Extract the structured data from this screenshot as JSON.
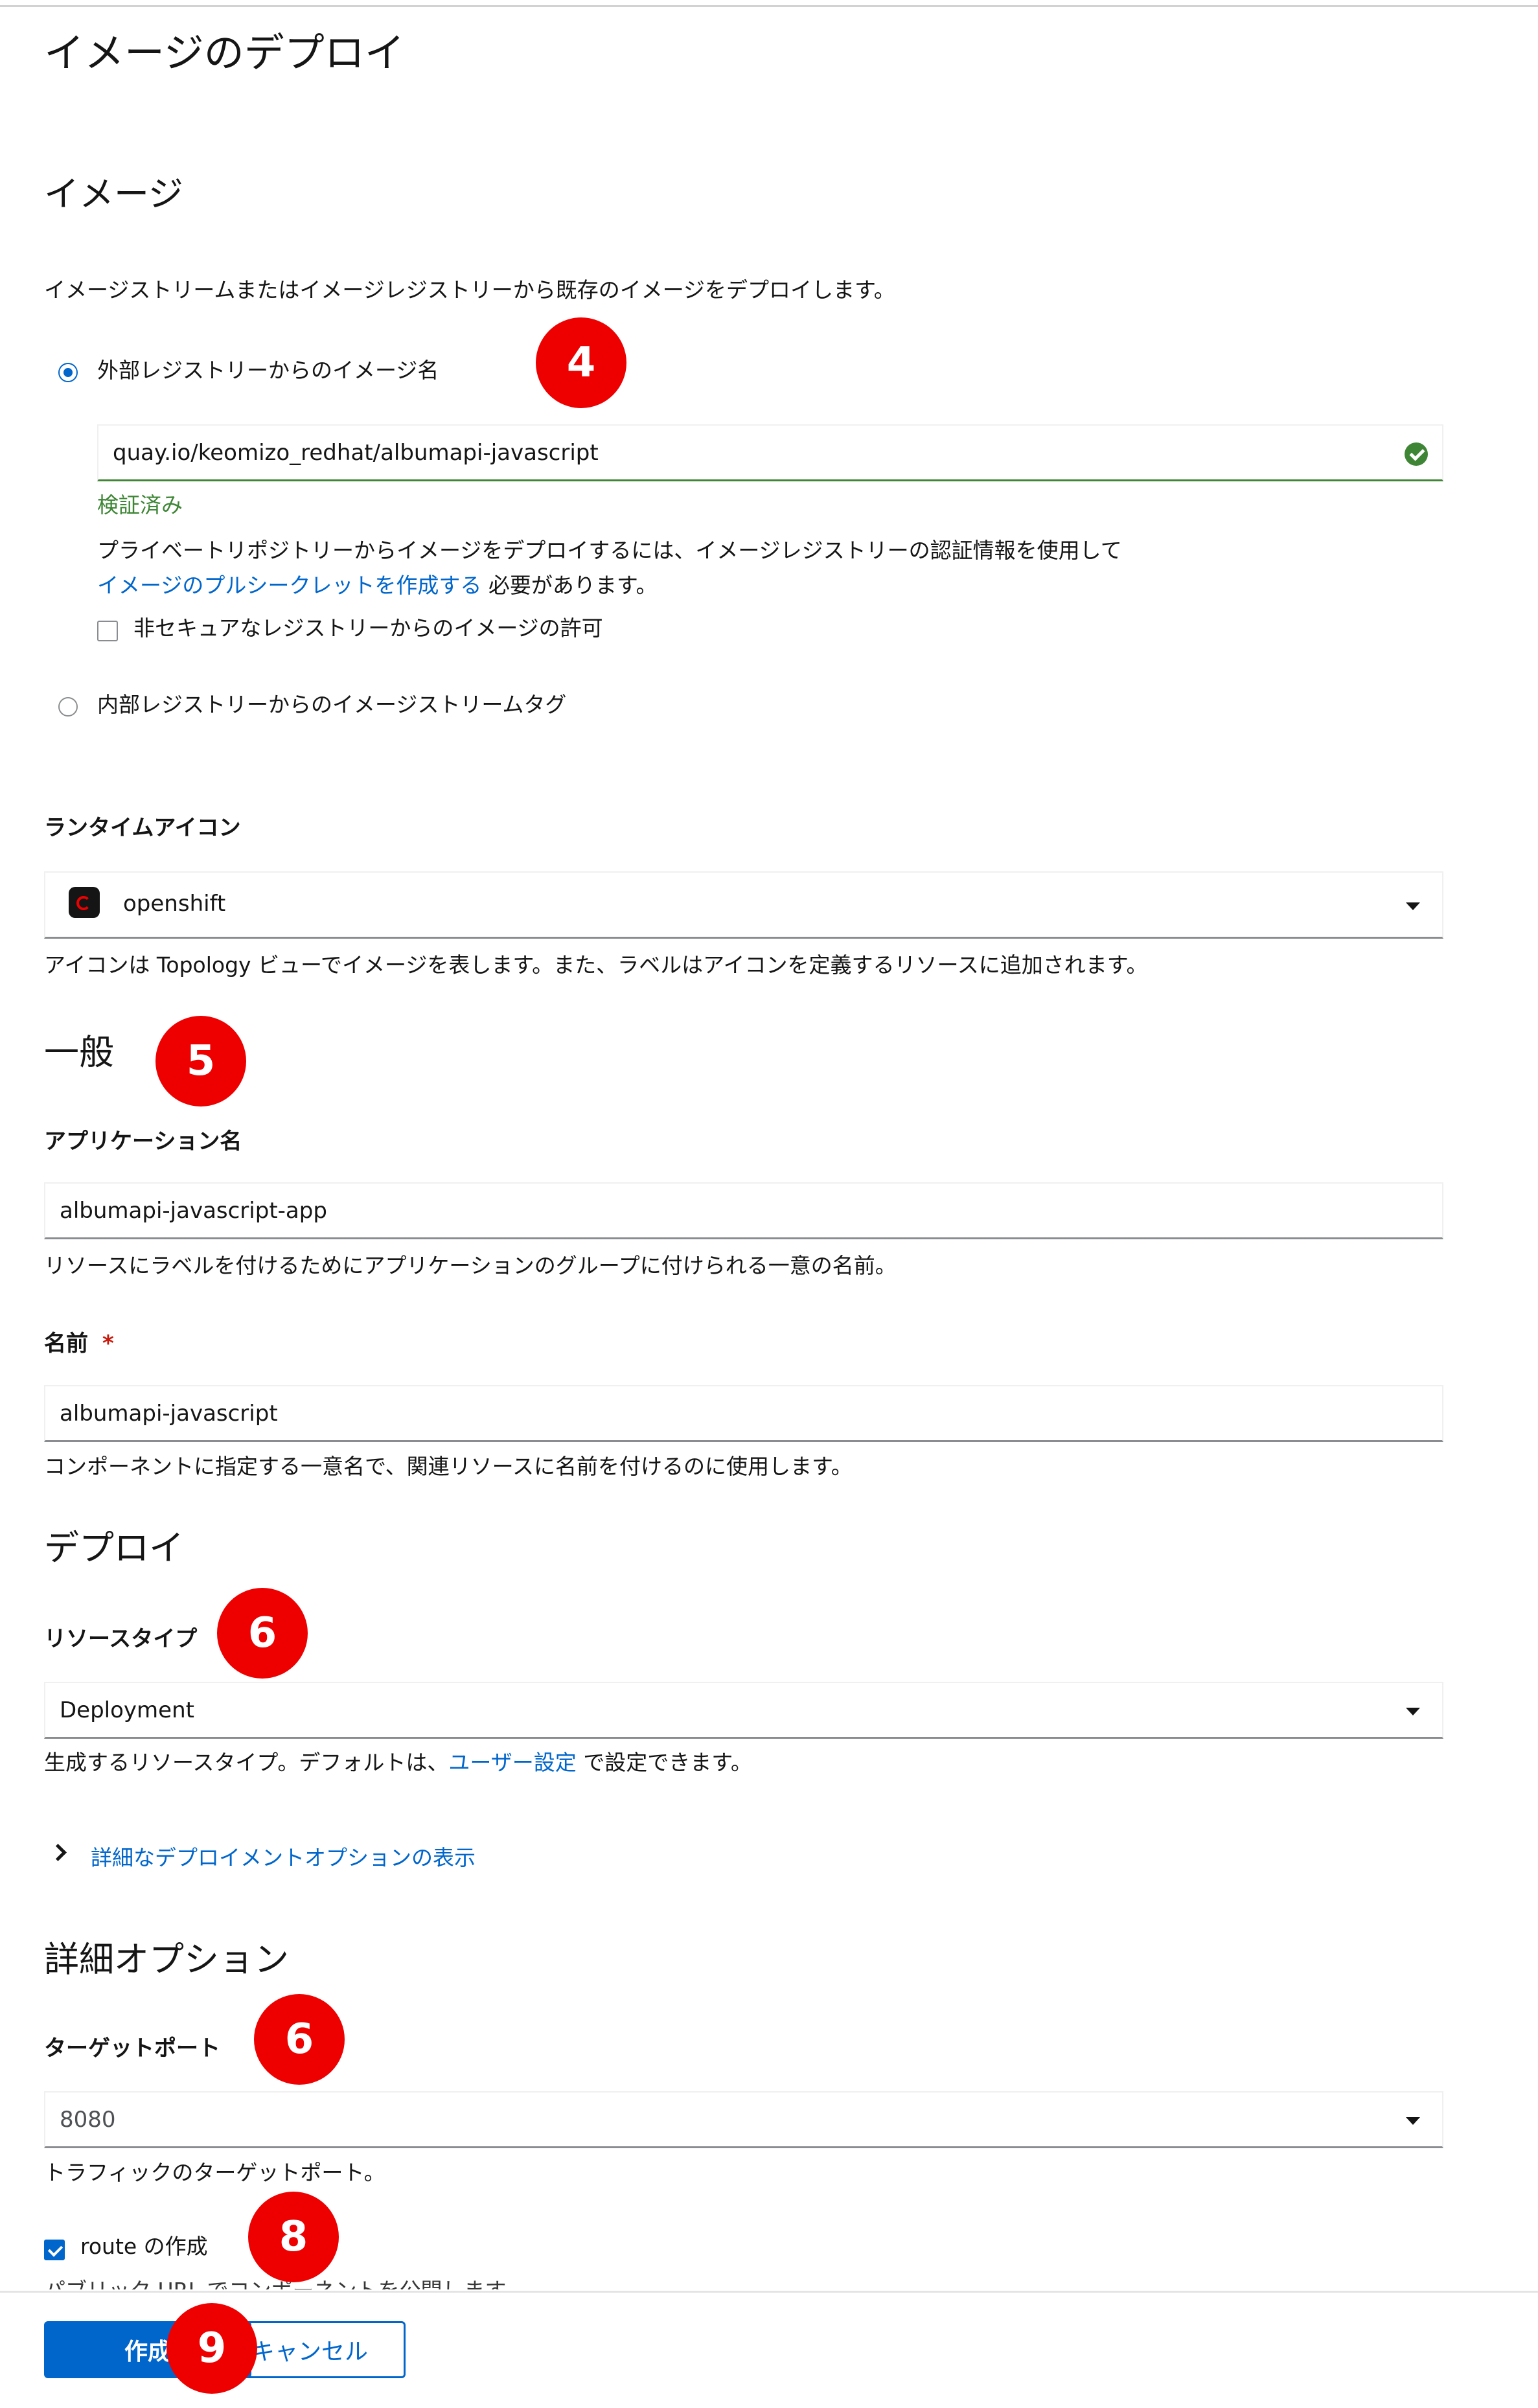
{
  "page_title": "イメージのデプロイ",
  "image_section": {
    "title": "イメージ",
    "description": "イメージストリームまたはイメージレジストリーから既存のイメージをデプロイします。",
    "external_radio_label": "外部レジストリーからのイメージ名",
    "external_radio_selected": true,
    "image_name_value": "quay.io/keomizo_redhat/albumapi-javascript",
    "validated_text": "検証済み",
    "pull_secret_text_1": "プライベートリポジトリーからイメージをデプロイするには、イメージレジストリーの認証情報を使用して",
    "pull_secret_link": "イメージのプルシークレットを作成する",
    "pull_secret_text_2": " 必要があります。",
    "insecure_checkbox_label": "非セキュアなレジストリーからのイメージの許可",
    "insecure_checked": false,
    "internal_radio_label": "内部レジストリーからのイメージストリームタグ",
    "internal_radio_selected": false
  },
  "runtime_icon": {
    "label": "ランタイムアイコン",
    "value": "openshift",
    "helper": "アイコンは Topology ビューでイメージを表します。また、ラベルはアイコンを定義するリソースに追加されます。"
  },
  "general_section": {
    "title": "一般",
    "app_name_label": "アプリケーション名",
    "app_name_value": "albumapi-javascript-app",
    "app_name_helper": "リソースにラベルを付けるためにアプリケーションのグループに付けられる一意の名前。",
    "name_label": "名前",
    "name_required_mark": "*",
    "name_value": "albumapi-javascript",
    "name_helper": "コンポーネントに指定する一意名で、関連リソースに名前を付けるのに使用します。"
  },
  "deploy_section": {
    "title": "デプロイ",
    "resource_type_label": "リソースタイプ",
    "resource_type_value": "Deployment",
    "resource_type_helper_1": "生成するリソースタイプ。デフォルトは、",
    "resource_type_helper_link": "ユーザー設定",
    "resource_type_helper_2": " で設定できます。",
    "advanced_deploy_toggle": "詳細なデプロイメントオプションの表示"
  },
  "advanced_section": {
    "title": "詳細オプション",
    "target_port_label": "ターゲットポート",
    "target_port_value": "8080",
    "target_port_helper": "トラフィックのターゲットポート。",
    "create_route_label": "route の作成",
    "create_route_checked": true,
    "create_route_helper": "パブリック URL でコンポーネントを公開します。"
  },
  "footer": {
    "create_button": "作成",
    "cancel_button": "キャンセル"
  },
  "callouts": [
    "4",
    "5",
    "6",
    "6",
    "8",
    "9"
  ],
  "colors": {
    "accent": "#0066cc",
    "success": "#3e8635",
    "callout": "#ee0000",
    "required": "#c9190b"
  }
}
